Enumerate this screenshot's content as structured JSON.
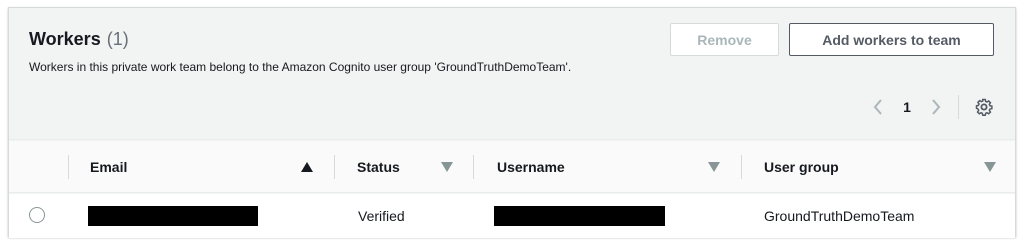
{
  "workers_panel": {
    "title": "Workers",
    "count": "(1)",
    "description": "Workers in this private work team belong to the Amazon Cognito user group 'GroundTruthDemoTeam'.",
    "buttons": {
      "remove_label": "Remove",
      "add_label": "Add workers to team"
    },
    "pagination": {
      "current_page": "1",
      "prev_icon": "chevron-left-icon",
      "next_icon": "chevron-right-icon",
      "settings_icon": "gear-icon"
    },
    "table": {
      "columns": [
        {
          "label": "Email",
          "sort": "ascending",
          "sort_icon": "sort-up-icon"
        },
        {
          "label": "Status",
          "sort": "none",
          "sort_icon": "sort-down-icon"
        },
        {
          "label": "Username",
          "sort": "none",
          "sort_icon": "sort-down-icon"
        },
        {
          "label": "User group",
          "sort": "none",
          "sort_icon": "sort-down-icon"
        }
      ],
      "rows": [
        {
          "selected": false,
          "email": "",
          "status": "Verified",
          "username": "",
          "user_group": "GroundTruthDemoTeam"
        }
      ]
    }
  },
  "colors": {
    "header_bg": "#f2f3f3",
    "table_header_bg": "#fafafa",
    "border": "#d5dbdb",
    "disabled_text": "#aab7b8",
    "text": "#16191f",
    "muted_text": "#687078",
    "redaction": "#000000"
  }
}
